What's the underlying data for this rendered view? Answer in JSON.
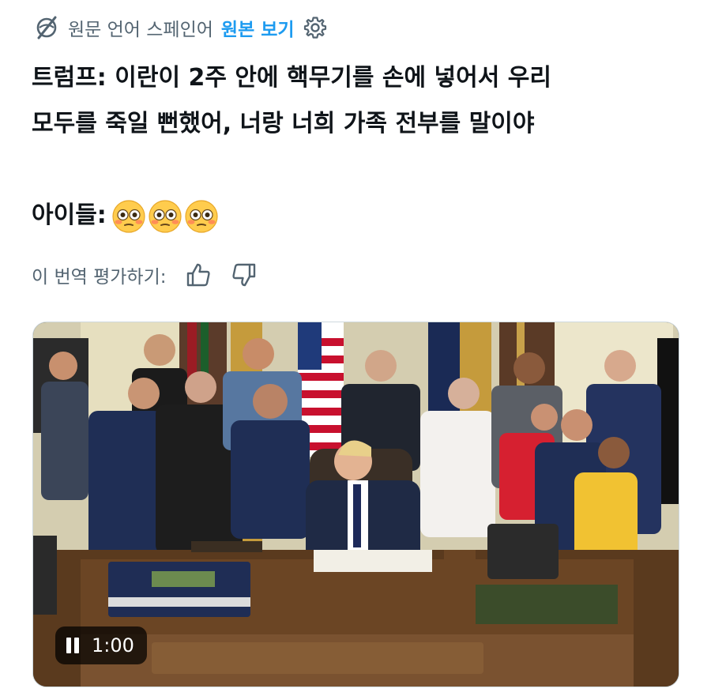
{
  "translation": {
    "source_language_label": "원문 언어 스페인어",
    "show_original_label": "원본 보기",
    "globe_icon": "globe-slash-icon",
    "settings_icon": "gear-icon"
  },
  "tweet": {
    "lines": [
      "트럼프: 이란이 2주 안에 핵무기를 손에 넣어서 우리",
      "모두를 죽일 뻔했어, 너랑 너희 가족 전부를 말이야",
      "아이들:"
    ],
    "emojis": [
      "flushed-face-emoji",
      "flushed-face-emoji",
      "flushed-face-emoji"
    ]
  },
  "rating": {
    "label": "이 번역 평가하기:",
    "thumbs_up_icon": "thumbs-up-icon",
    "thumbs_down_icon": "thumbs-down-icon"
  },
  "video": {
    "time": "1:00",
    "state_icon": "pause-icon"
  }
}
